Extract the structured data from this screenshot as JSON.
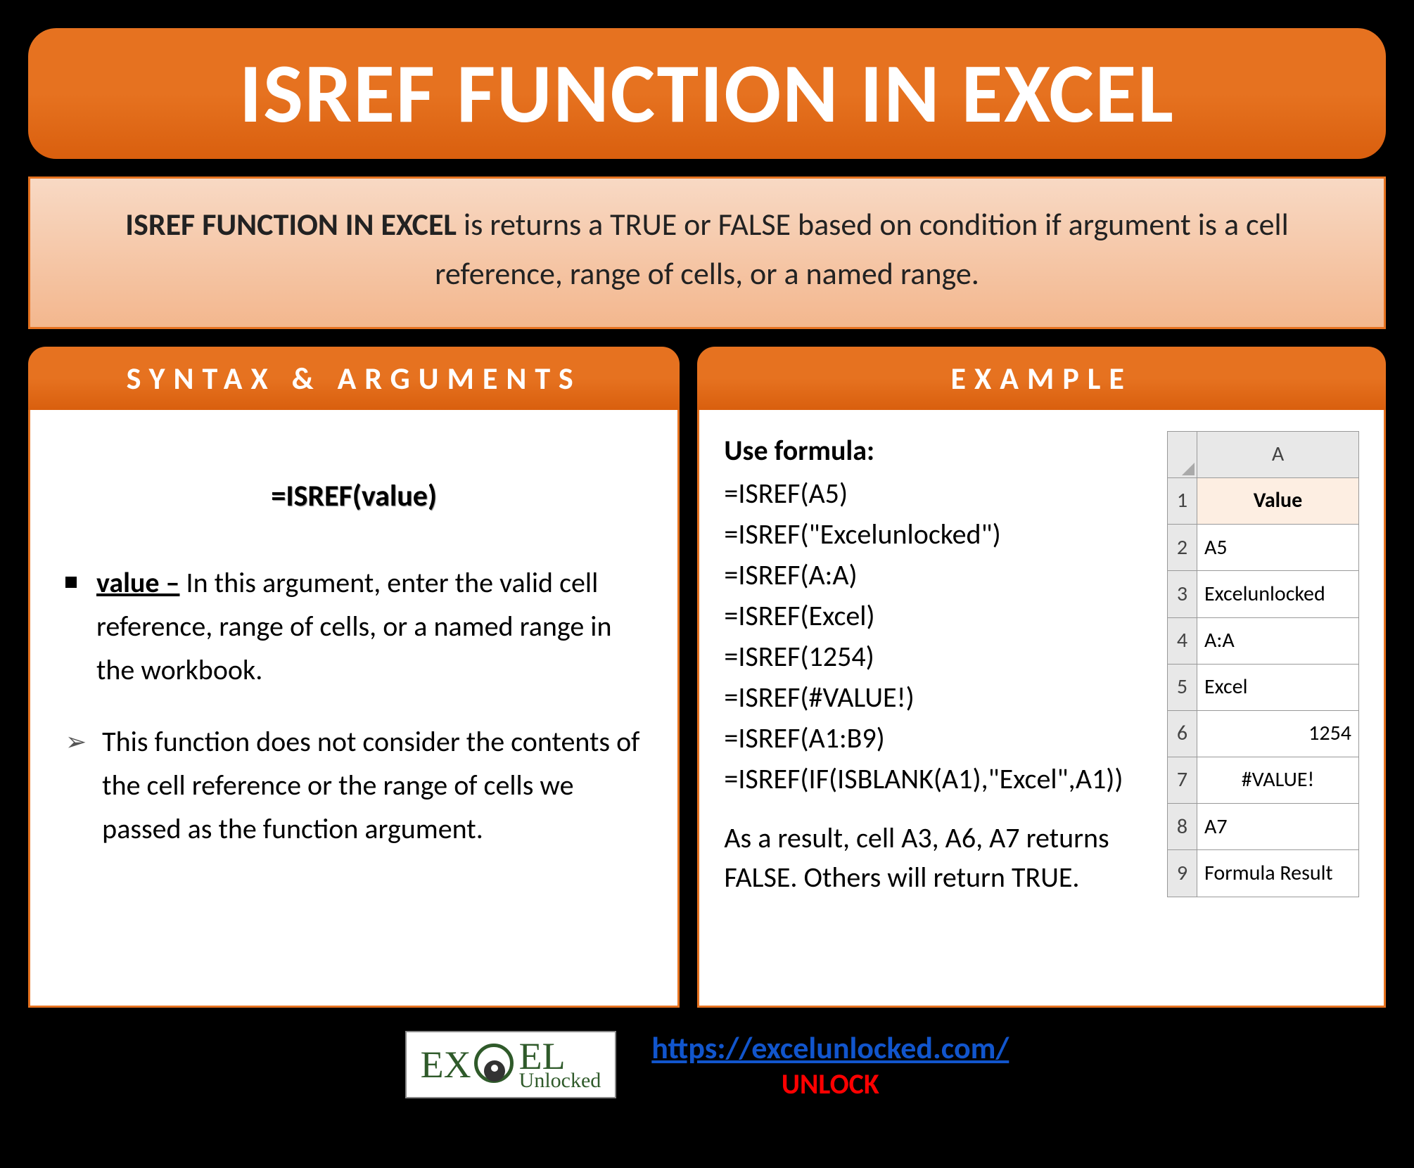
{
  "title": "ISREF FUNCTION IN EXCEL",
  "description": {
    "bold_lead": "ISREF FUNCTION IN EXCEL",
    "rest": " is returns a TRUE or FALSE based on condition if argument is a cell reference, range of cells, or a named range."
  },
  "syntax": {
    "header": "SYNTAX & ARGUMENTS",
    "formula": "=ISREF(value)",
    "arg_label": "value –",
    "arg_text": " In this argument, enter the valid cell reference, range of cells, or a named range in the workbook.",
    "note": "This function does not consider the contents of the cell reference or the range of cells we passed as the function argument."
  },
  "example": {
    "header": "EXAMPLE",
    "use_label": "Use formula:",
    "formulas": [
      "=ISREF(A5)",
      "=ISREF(\"Excelunlocked\")",
      "=ISREF(A:A)",
      "=ISREF(Excel)",
      "=ISREF(1254)",
      "=ISREF(#VALUE!)",
      "=ISREF(A1:B9)",
      "=ISREF(IF(ISBLANK(A1),\"Excel\",A1))"
    ],
    "result_text": "As a result, cell A3, A6, A7 returns FALSE. Others will return TRUE.",
    "table": {
      "col": "A",
      "header": "Value",
      "rows": [
        {
          "n": "2",
          "v": "A5",
          "align": "left"
        },
        {
          "n": "3",
          "v": "Excelunlocked",
          "align": "left"
        },
        {
          "n": "4",
          "v": "A:A",
          "align": "left"
        },
        {
          "n": "5",
          "v": "Excel",
          "align": "left"
        },
        {
          "n": "6",
          "v": "1254",
          "align": "right"
        },
        {
          "n": "7",
          "v": "#VALUE!",
          "align": "center"
        },
        {
          "n": "8",
          "v": "A7",
          "align": "left"
        },
        {
          "n": "9",
          "v": "Formula Result",
          "align": "left"
        }
      ]
    }
  },
  "footer": {
    "logo_main": "EX   EL",
    "logo_sub": "Unlocked",
    "url": "https://excelunlocked.com/",
    "unlock": "UNLOCK"
  }
}
